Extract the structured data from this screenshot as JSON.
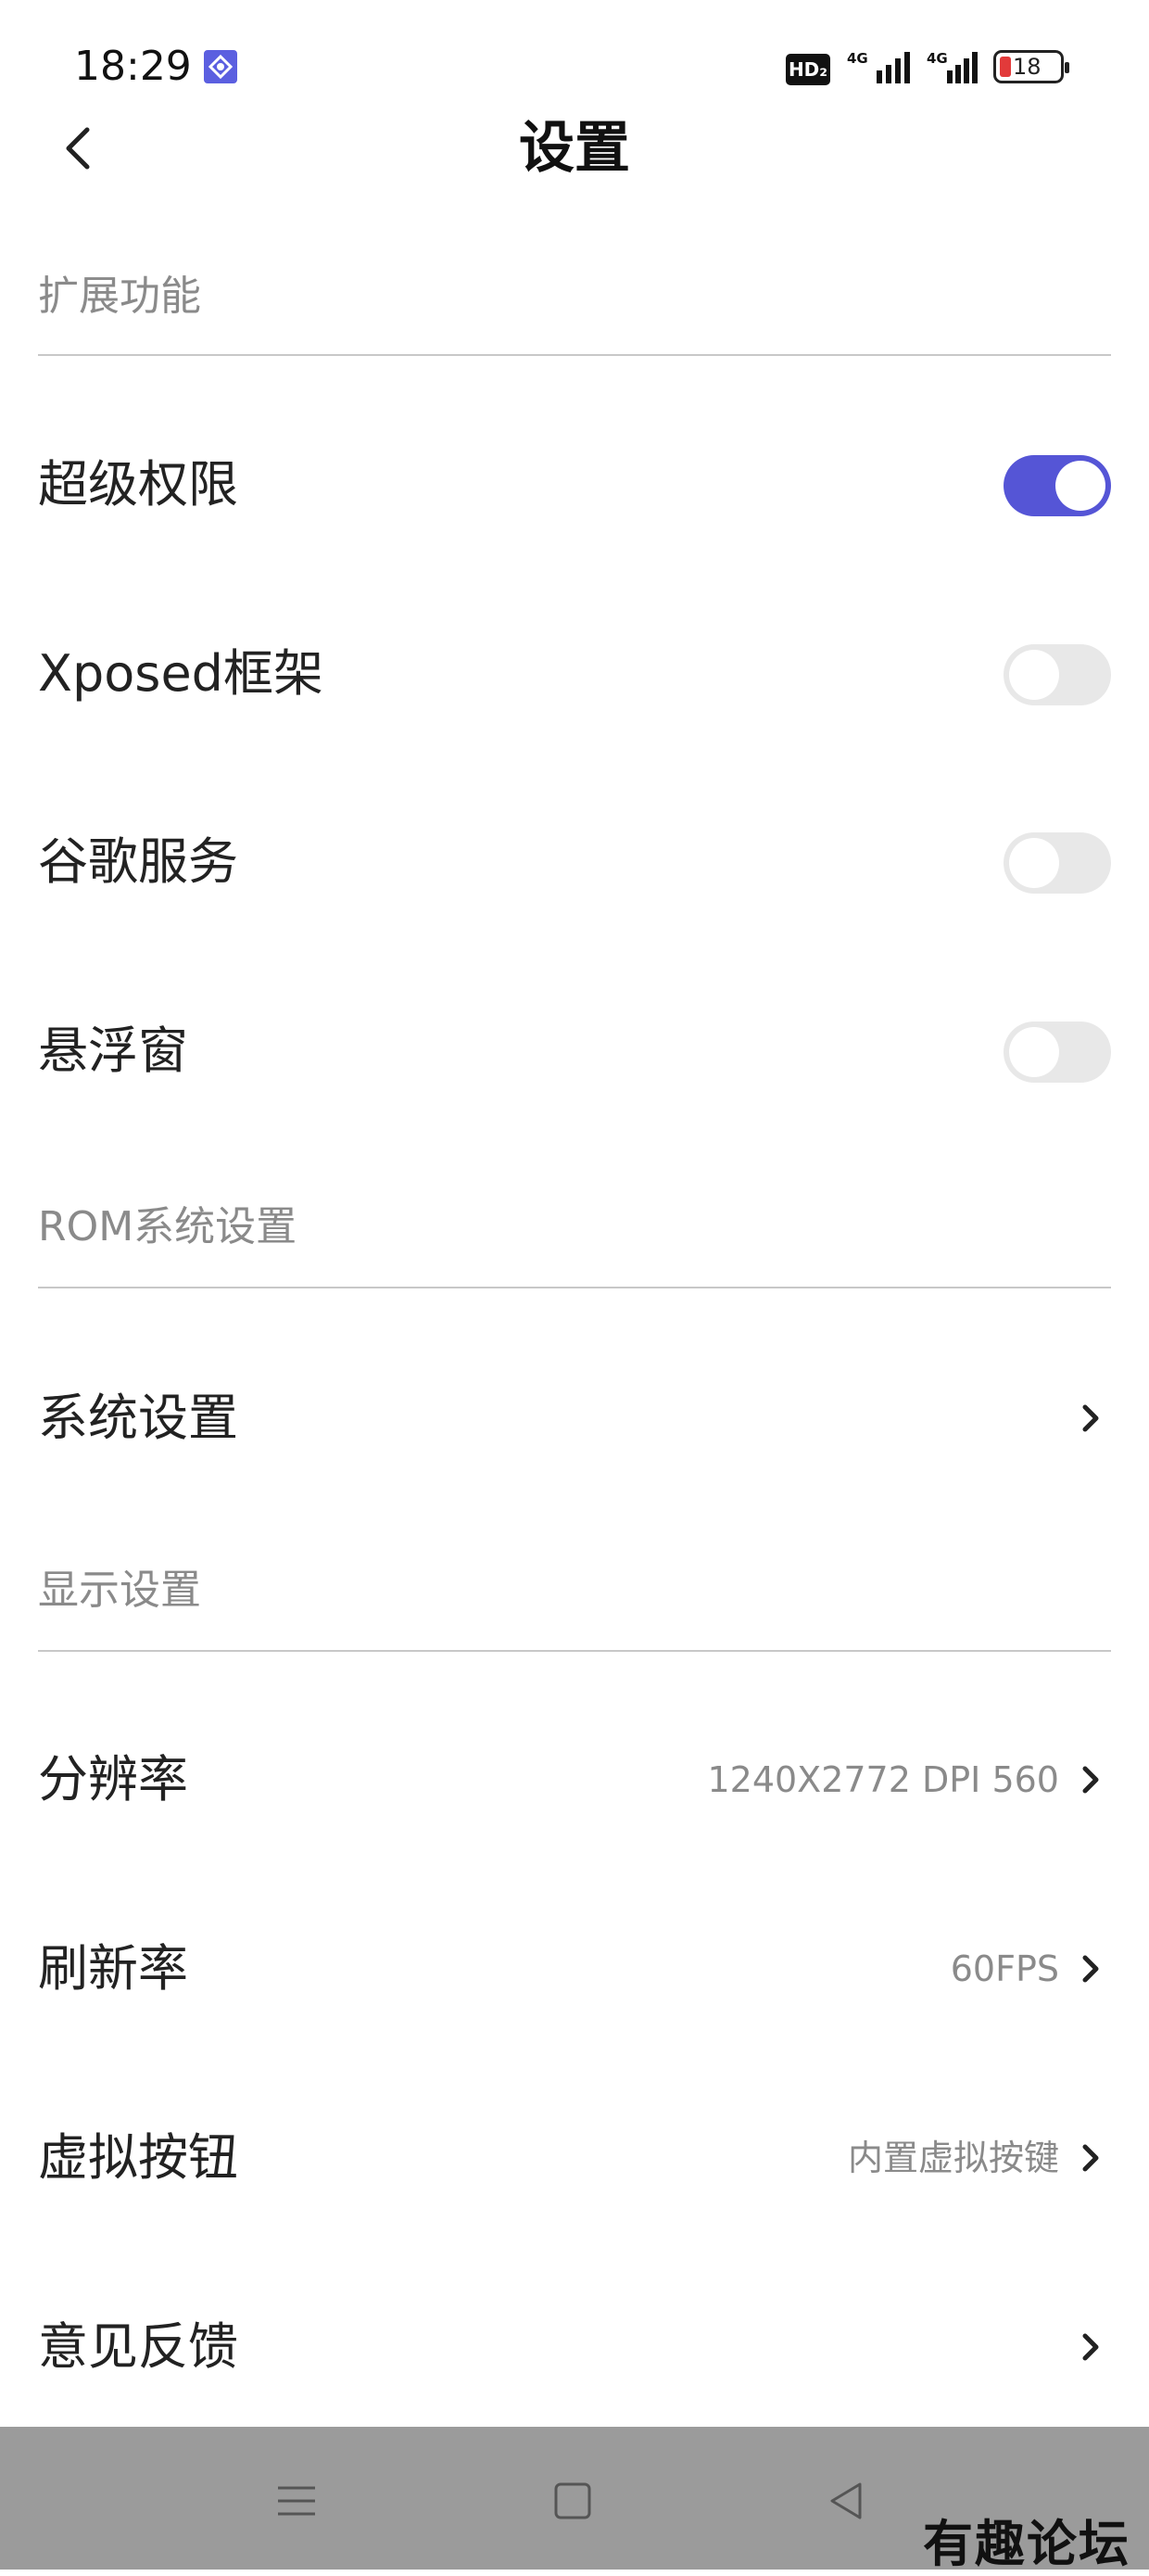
{
  "status_bar": {
    "time": "18:29",
    "hd_label": "HD₂",
    "signal1_label": "4G",
    "signal2_label": "4G",
    "battery": "18"
  },
  "header": {
    "title": "设置"
  },
  "sections": {
    "extensions": "扩展功能",
    "rom": "ROM系统设置",
    "display": "显示设置"
  },
  "extensions": {
    "super_permission": {
      "label": "超级权限",
      "enabled": true
    },
    "xposed": {
      "label": "Xposed框架",
      "enabled": false
    },
    "google_services": {
      "label": "谷歌服务",
      "enabled": false
    },
    "floating_window": {
      "label": "悬浮窗",
      "enabled": false
    }
  },
  "rom": {
    "system_settings": {
      "label": "系统设置"
    }
  },
  "display": {
    "resolution": {
      "label": "分辨率",
      "value": "1240X2772 DPI 560"
    },
    "refresh_rate": {
      "label": "刷新率",
      "value": "60FPS"
    },
    "virtual_buttons": {
      "label": "虚拟按钮",
      "value": "内置虚拟按键"
    },
    "feedback": {
      "label": "意见反馈"
    }
  },
  "watermark": "有趣论坛",
  "colors": {
    "accent": "#5555d6",
    "toggle_off": "#e8e8e8",
    "navbar": "#9b9b9b",
    "section_text": "#8a8a8a"
  }
}
